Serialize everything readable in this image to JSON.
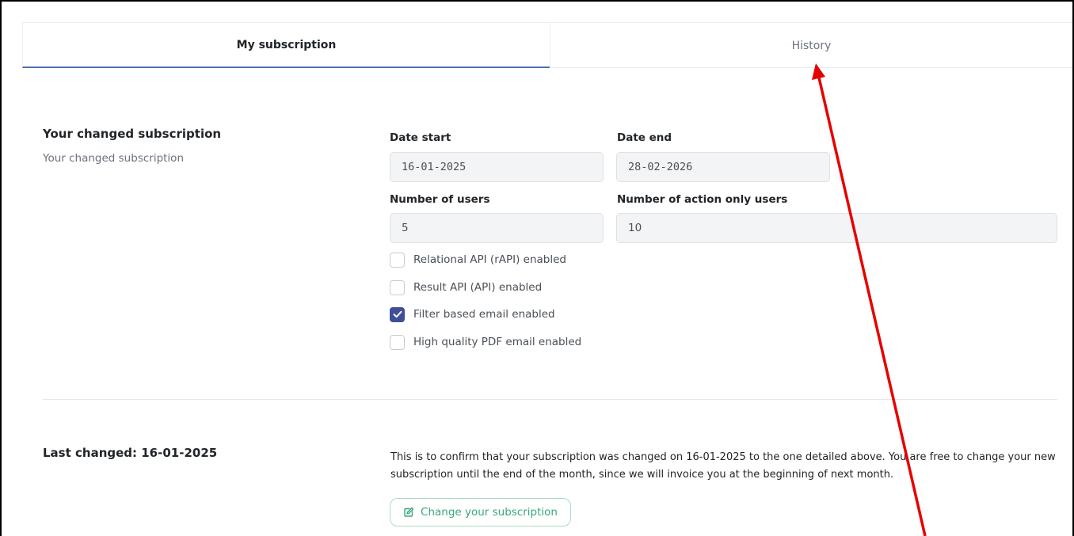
{
  "tabs": [
    {
      "label": "My subscription",
      "active": true
    },
    {
      "label": "History",
      "active": false
    }
  ],
  "section1": {
    "title": "Your changed subscription",
    "subtitle": "Your changed subscription"
  },
  "fields": {
    "date_start": {
      "label": "Date start",
      "value": "16-01-2025"
    },
    "date_end": {
      "label": "Date end",
      "value": "28-02-2026"
    },
    "num_users": {
      "label": "Number of users",
      "value": "5"
    },
    "num_action_users": {
      "label": "Number of action only users",
      "value": "10"
    }
  },
  "checkboxes": [
    {
      "label": "Relational API (rAPI) enabled",
      "checked": false
    },
    {
      "label": "Result API (API) enabled",
      "checked": false
    },
    {
      "label": "Filter based email enabled",
      "checked": true
    },
    {
      "label": "High quality PDF email enabled",
      "checked": false
    }
  ],
  "section2": {
    "title": "Last changed: 16-01-2025",
    "confirmation": "This is to confirm that your subscription was changed on 16-01-2025 to the one detailed above. You are free to change your new subscription until the end of the month, since we will invoice you at the beginning of next month.",
    "button_label": "Change your subscription",
    "button_icon": "edit-icon"
  },
  "colors": {
    "tab_active_underline": "#4d6fb3",
    "checkbox_checked": "#3f4f97",
    "button_accent": "#3aa876",
    "annotation_arrow": "#e60000"
  }
}
